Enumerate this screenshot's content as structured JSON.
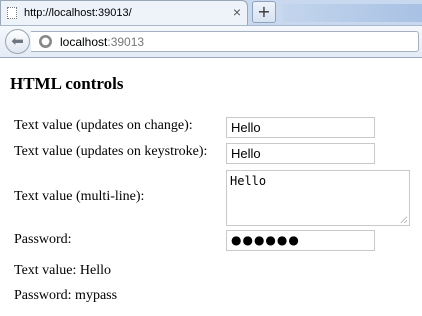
{
  "browser": {
    "tab_title": "http://localhost:39013/",
    "new_tab_label": "+",
    "address": {
      "host": "localhost",
      "port": ":39013"
    }
  },
  "page": {
    "heading": "HTML controls",
    "controls": {
      "text_change_label": "Text value (updates on change):",
      "text_change_value": "Hello",
      "text_keystroke_label": "Text value (updates on keystroke):",
      "text_keystroke_value": "Hello",
      "multiline_label": "Text value (multi-line):",
      "multiline_value": "Hello",
      "password_label": "Password:",
      "password_masked": "●●●●●●"
    },
    "output": {
      "text_value": "Text value: Hello",
      "password": "Password: mypass"
    }
  }
}
